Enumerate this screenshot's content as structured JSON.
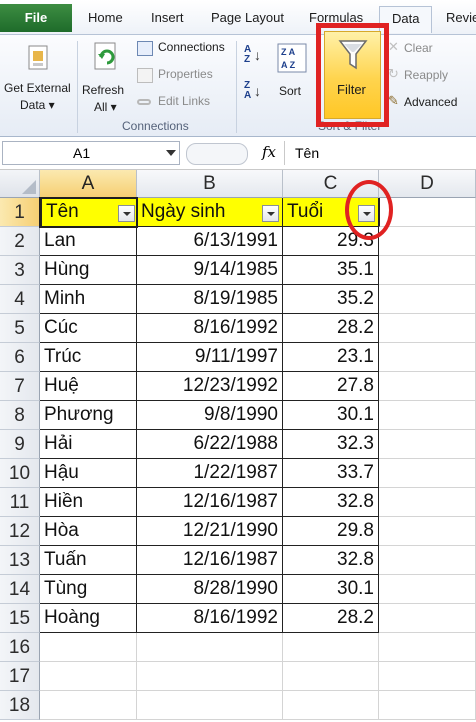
{
  "tabs": {
    "file": "File",
    "home": "Home",
    "insert": "Insert",
    "page_layout": "Page Layout",
    "formulas": "Formulas",
    "data": "Data",
    "review": "Revie"
  },
  "ribbon": {
    "get_external_data": [
      "Get External",
      "Data ▾"
    ],
    "refresh_all": [
      "Refresh",
      "All ▾"
    ],
    "connections": "Connections",
    "properties": "Properties",
    "edit_links": "Edit Links",
    "connections_group": "Connections",
    "sort": "Sort",
    "filter": "Filter",
    "clear": "Clear",
    "reapply": "Reapply",
    "advanced": "Advanced",
    "sort_filter_group": "Sort & Filter"
  },
  "formula_bar": {
    "name_box": "A1",
    "fx": "fx",
    "content": "Tên"
  },
  "grid": {
    "columns": [
      "A",
      "B",
      "C",
      "D"
    ],
    "selected_column": "A",
    "header": [
      "Tên",
      "Ngày sinh",
      "Tuổi"
    ],
    "rows": [
      [
        "Lan",
        "6/13/1991",
        "29.3"
      ],
      [
        "Hùng",
        "9/14/1985",
        "35.1"
      ],
      [
        "Minh",
        "8/19/1985",
        "35.2"
      ],
      [
        "Cúc",
        "8/16/1992",
        "28.2"
      ],
      [
        "Trúc",
        "9/11/1997",
        "23.1"
      ],
      [
        "Huệ",
        "12/23/1992",
        "27.8"
      ],
      [
        "Phương",
        "9/8/1990",
        "30.1"
      ],
      [
        "Hải",
        "6/22/1988",
        "32.3"
      ],
      [
        "Hậu",
        "1/22/1987",
        "33.7"
      ],
      [
        "Hiền",
        "12/16/1987",
        "32.8"
      ],
      [
        "Hòa",
        "12/21/1990",
        "29.8"
      ],
      [
        "Tuấn",
        "12/16/1987",
        "32.8"
      ],
      [
        "Tùng",
        "8/28/1990",
        "30.1"
      ],
      [
        "Hoàng",
        "8/16/1992",
        "28.2"
      ]
    ],
    "row_numbers": [
      "1",
      "2",
      "3",
      "4",
      "5",
      "6",
      "7",
      "8",
      "9",
      "10",
      "11",
      "12",
      "13",
      "14",
      "15",
      "16",
      "17",
      "18"
    ]
  },
  "colors": {
    "header_fill": "#ffff00",
    "highlight": "#e02222",
    "file_tab": "#2a7a35"
  }
}
